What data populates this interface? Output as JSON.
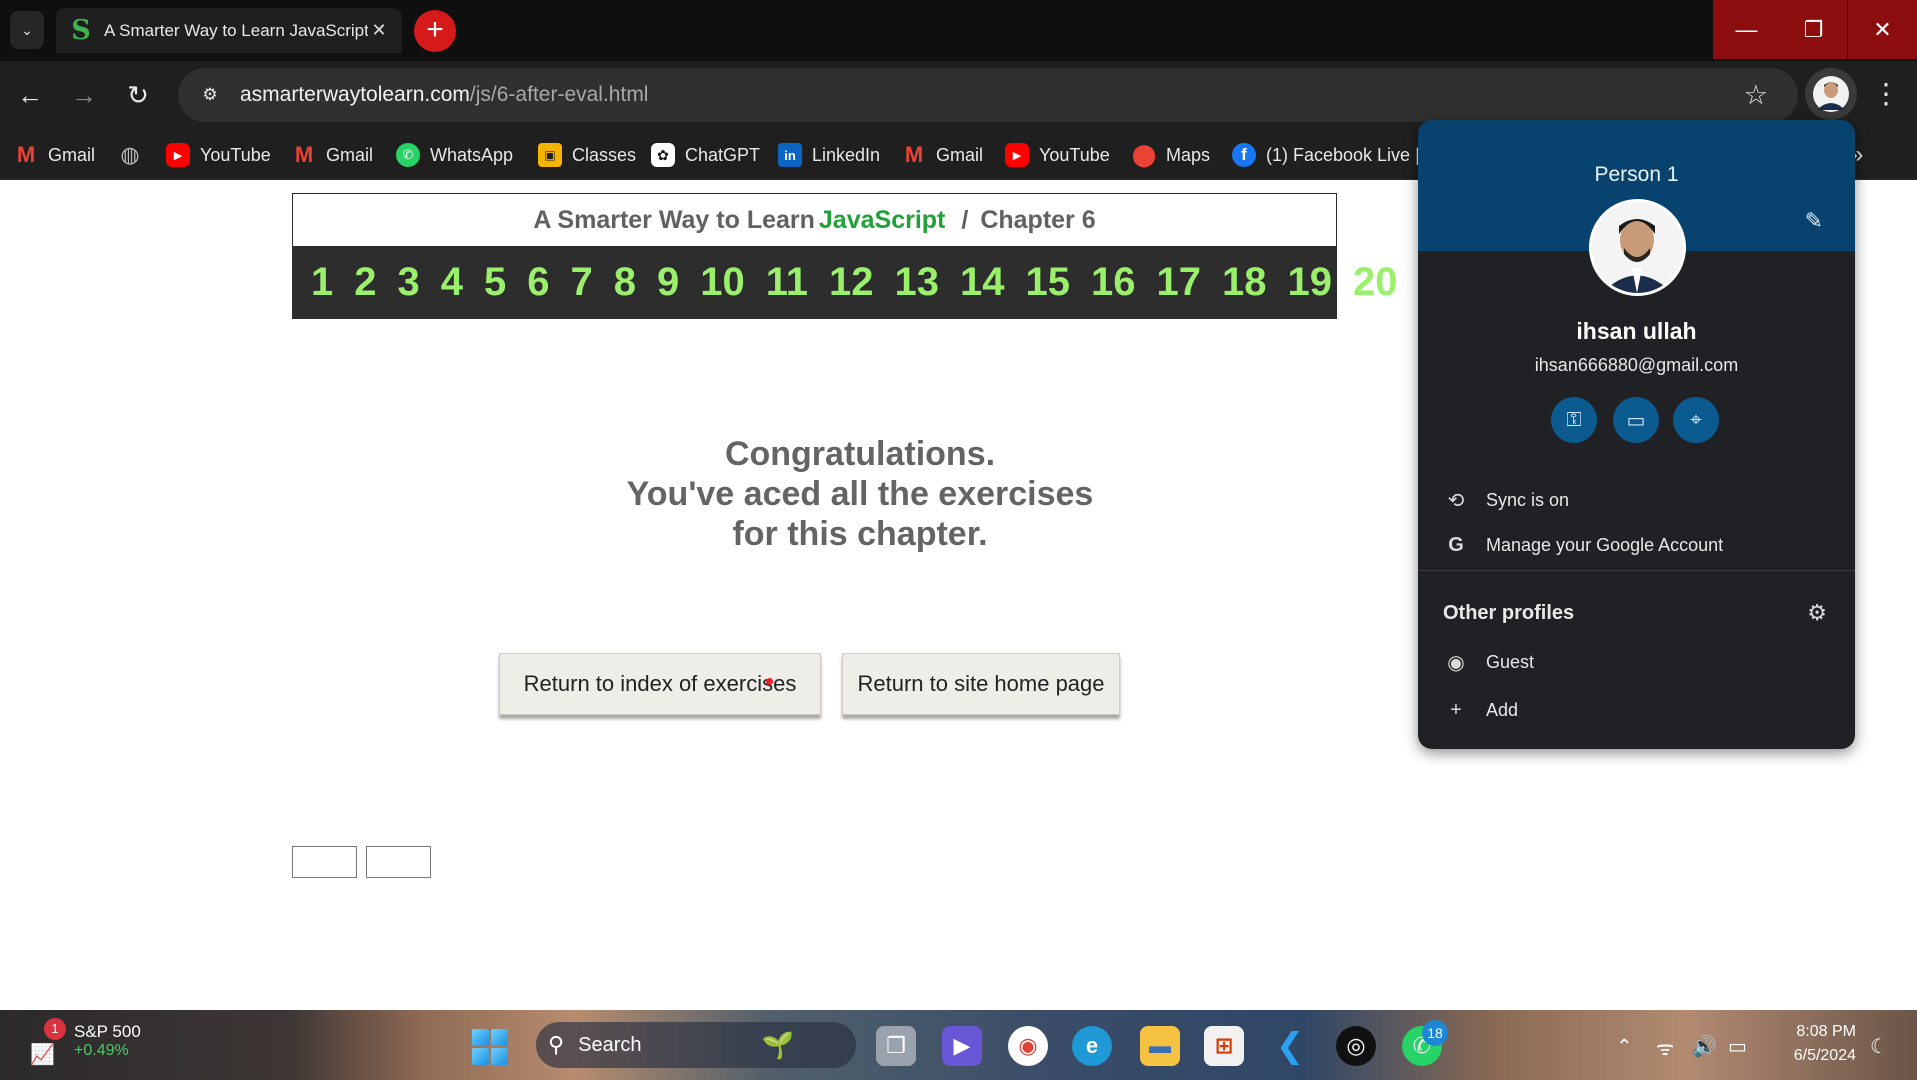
{
  "browser": {
    "tab_title": "A Smarter Way to Learn JavaScript",
    "tab_favicon": "S",
    "url_host": "asmarterwaytolearn.com",
    "url_path": "/js/6-after-eval.html",
    "bookmarks": [
      {
        "label": "Gmail",
        "icon": "gmail-icon"
      },
      {
        "label": "",
        "icon": "globe-icon"
      },
      {
        "label": "YouTube",
        "icon": "youtube-icon"
      },
      {
        "label": "Gmail",
        "icon": "gmail-icon"
      },
      {
        "label": "WhatsApp",
        "icon": "whatsapp-icon"
      },
      {
        "label": "Classes",
        "icon": "classroom-icon"
      },
      {
        "label": "ChatGPT",
        "icon": "chatgpt-icon"
      },
      {
        "label": "LinkedIn",
        "icon": "linkedin-icon"
      },
      {
        "label": "Gmail",
        "icon": "gmail-icon"
      },
      {
        "label": "YouTube",
        "icon": "youtube-icon"
      },
      {
        "label": "Maps",
        "icon": "maps-icon"
      },
      {
        "label": "(1) Facebook Live |",
        "icon": "facebook-icon"
      }
    ]
  },
  "page": {
    "header": {
      "prefix": "A Smarter Way to Learn",
      "highlight": "JavaScript",
      "separator": "/",
      "chapter": "Chapter 6"
    },
    "chapters": [
      "1",
      "2",
      "3",
      "4",
      "5",
      "6",
      "7",
      "8",
      "9",
      "10",
      "11",
      "12",
      "13",
      "14",
      "15",
      "16",
      "17",
      "18",
      "19",
      "20"
    ],
    "congrats": {
      "line1": "Congratulations.",
      "line2": "You've aced all the exercises",
      "line3": "for this chapter."
    },
    "buttons": {
      "index": "Return to index of exercises",
      "home": "Return to site home page"
    }
  },
  "profile_popup": {
    "profile_name": "Person 1",
    "user_name": "ihsan ullah",
    "email": "ihsan666880@gmail.com",
    "sync": "Sync is on",
    "manage": "Manage your Google Account",
    "other_profiles": "Other profiles",
    "guest": "Guest",
    "add": "Add"
  },
  "taskbar": {
    "stock_name": "S&P 500",
    "stock_change": "+0.49%",
    "stock_badge": "1",
    "search_placeholder": "Search",
    "whatsapp_badge": "18",
    "time": "8:08 PM",
    "date": "6/5/2024"
  },
  "colors": {
    "accent_green": "#22a03a",
    "chapter_green": "#9af06b",
    "popup_blue": "#07436e",
    "close_red": "#8b0d0d"
  }
}
